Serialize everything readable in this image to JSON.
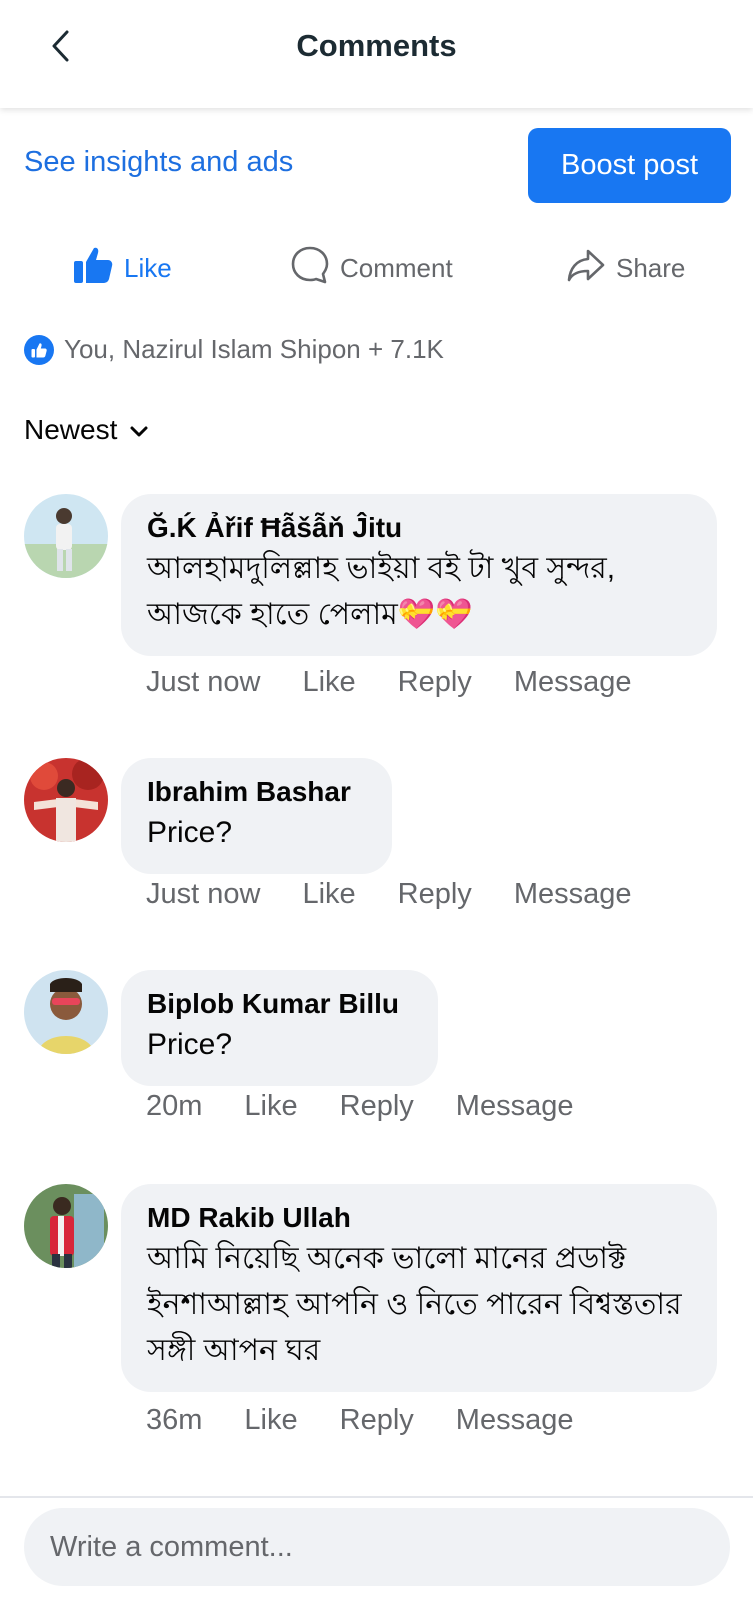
{
  "header": {
    "title": "Comments",
    "back_icon": "chevron-left-icon"
  },
  "promo": {
    "insights_label": "See insights and ads",
    "boost_label": "Boost post",
    "boost_color": "#1877f2"
  },
  "actions": {
    "like_label": "Like",
    "comment_label": "Comment",
    "share_label": "Share"
  },
  "reactions": {
    "summary": "You, Nazirul Islam Shipon + 7.1K"
  },
  "sort": {
    "label": "Newest"
  },
  "comments": [
    {
      "name": "Ğ.Ḱ Ảřif Ħẫšẫň Ĵitu",
      "text": "আলহামদুলিল্লাহ ভাইয়া বই টা খুব সুন্দর, আজকে হাতে পেলাম💝💝",
      "time": "Just now",
      "like": "Like",
      "reply": "Reply",
      "message": "Message"
    },
    {
      "name": "Ibrahim Bashar",
      "text": "Price?",
      "time": "Just now",
      "like": "Like",
      "reply": "Reply",
      "message": "Message"
    },
    {
      "name": "Biplob Kumar Billu",
      "text": "Price?",
      "time": "20m",
      "like": "Like",
      "reply": "Reply",
      "message": "Message"
    },
    {
      "name": "MD Rakib Ullah",
      "text": "আমি নিয়েছি অনেক ভালো মানের প্রডাক্ট ইনশাআল্লাহ আপনি ও নিতে পারেন বিশ্বস্ততার সঙ্গী আপন ঘর",
      "time": "36m",
      "like": "Like",
      "reply": "Reply",
      "message": "Message"
    }
  ],
  "composer": {
    "placeholder": "Write a comment..."
  }
}
